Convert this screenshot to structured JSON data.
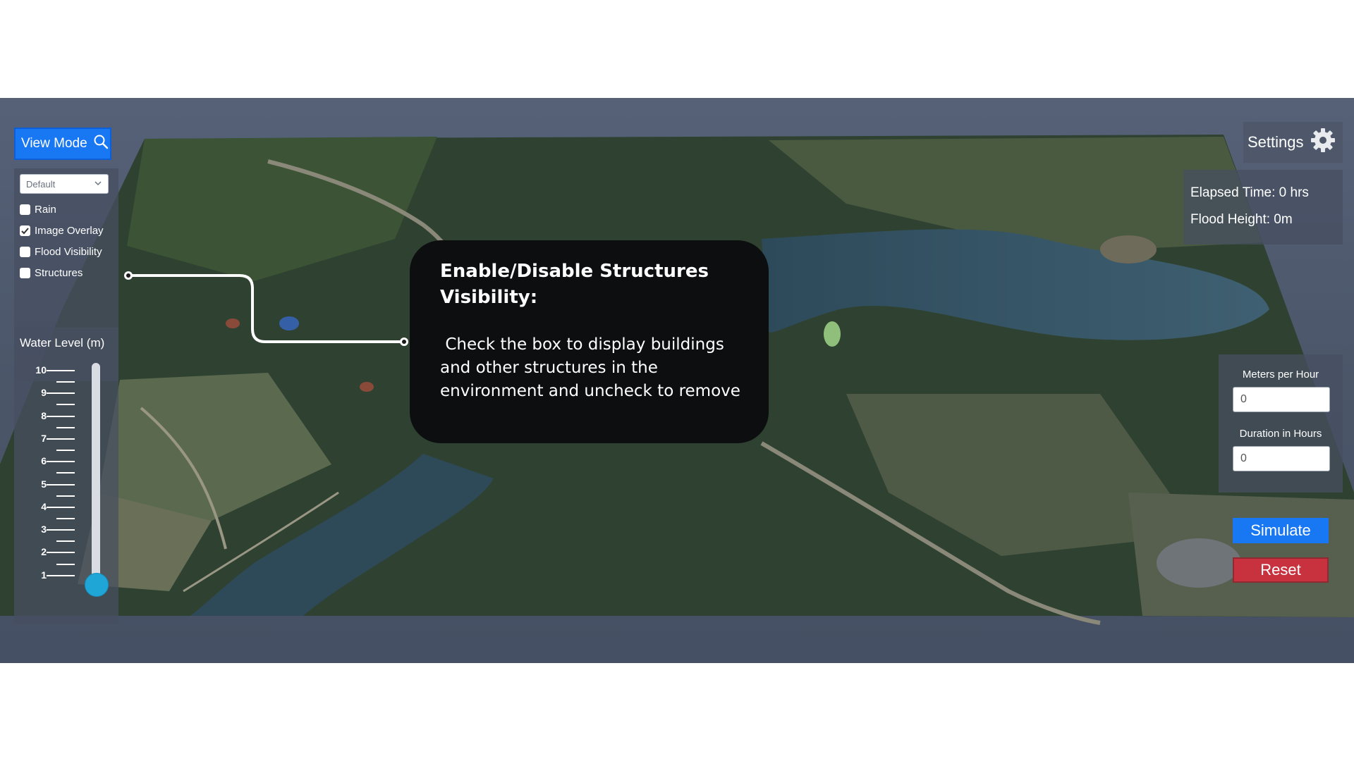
{
  "toolbar": {
    "view_mode_label": "View Mode",
    "view_mode_icon": "search-icon"
  },
  "layers": {
    "selected_mode": "Default",
    "checkboxes": [
      {
        "label": "Rain",
        "checked": false
      },
      {
        "label": "Image Overlay",
        "checked": true
      },
      {
        "label": "Flood Visibility",
        "checked": false
      },
      {
        "label": "Structures",
        "checked": false
      }
    ]
  },
  "water_level": {
    "title": "Water Level (m)",
    "scale": [
      "10",
      "9",
      "8",
      "7",
      "6",
      "5",
      "4",
      "3",
      "2",
      "1"
    ],
    "value": 1
  },
  "settings": {
    "label": "Settings",
    "icon": "gear-icon"
  },
  "status": {
    "elapsed_time": "Elapsed Time: 0 hrs",
    "flood_height": "Flood Height: 0m"
  },
  "simulation": {
    "meters_per_hour_label": "Meters per Hour",
    "meters_per_hour_value": "0",
    "duration_label": "Duration in Hours",
    "duration_value": "0",
    "simulate_label": "Simulate",
    "reset_label": "Reset"
  },
  "tooltip": {
    "title": "Enable/Disable Structures Visibility:",
    "body": " Check the box to display buildings and other structures in the environment and uncheck to remove"
  },
  "colors": {
    "primary": "#1877f2",
    "danger": "#c8323f",
    "panel": "#464f61",
    "slider_thumb": "#1fa5d6",
    "tooltip_bg": "#0d0e10"
  }
}
